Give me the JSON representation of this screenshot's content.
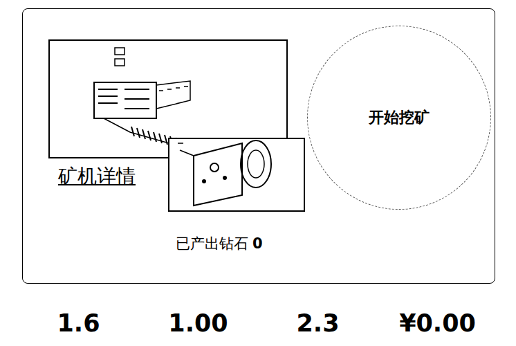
{
  "card": {
    "machine_details_link": "矿机详情",
    "start_button": "开始挖矿",
    "output": {
      "label": "已产出钻石",
      "value": "0"
    }
  },
  "stats": [
    {
      "value": "1.6"
    },
    {
      "value": "1.00"
    },
    {
      "value": "2.3"
    },
    {
      "value": "¥0.00"
    }
  ]
}
